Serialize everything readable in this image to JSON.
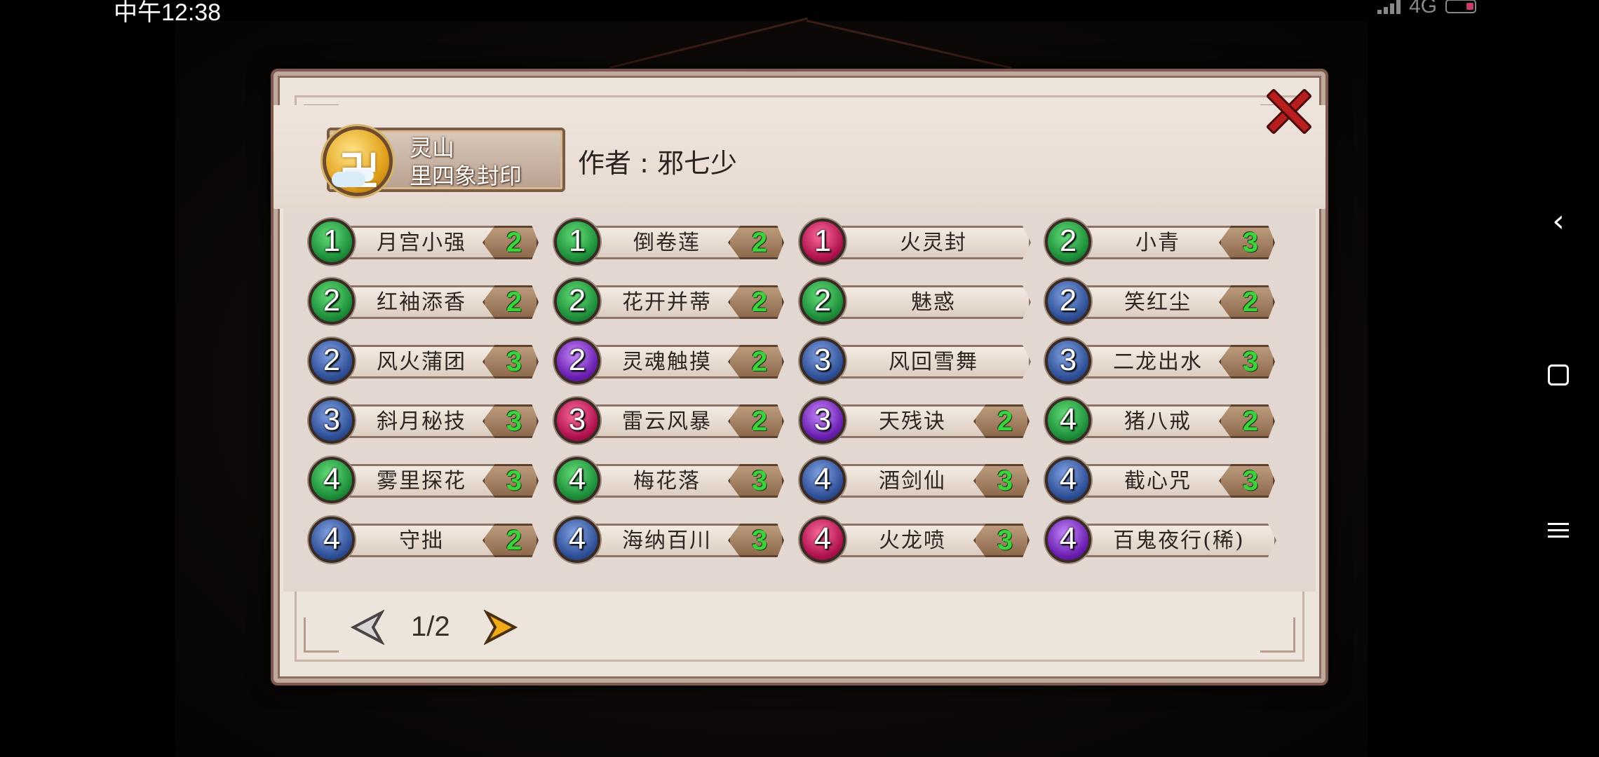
{
  "status": {
    "time": "中午12:38",
    "network": "4G"
  },
  "dialog": {
    "seal_line1": "灵山",
    "seal_line2": "里四象封印",
    "seal_glyph": "卍",
    "author": "作者 : 邪七少",
    "page": "1/2"
  },
  "skills": [
    {
      "level": "1",
      "name": "月宫小强",
      "cost": "2",
      "color": "green"
    },
    {
      "level": "1",
      "name": "倒卷莲",
      "cost": "2",
      "color": "green"
    },
    {
      "level": "1",
      "name": "火灵封",
      "cost": "",
      "color": "red"
    },
    {
      "level": "2",
      "name": "小青",
      "cost": "3",
      "color": "green"
    },
    {
      "level": "2",
      "name": "红袖添香",
      "cost": "2",
      "color": "green"
    },
    {
      "level": "2",
      "name": "花开并蒂",
      "cost": "2",
      "color": "green"
    },
    {
      "level": "2",
      "name": "魅惑",
      "cost": "",
      "color": "green"
    },
    {
      "level": "2",
      "name": "笑红尘",
      "cost": "2",
      "color": "blue"
    },
    {
      "level": "2",
      "name": "风火蒲团",
      "cost": "3",
      "color": "blue"
    },
    {
      "level": "2",
      "name": "灵魂触摸",
      "cost": "2",
      "color": "purple"
    },
    {
      "level": "3",
      "name": "风回雪舞",
      "cost": "",
      "color": "blue"
    },
    {
      "level": "3",
      "name": "二龙出水",
      "cost": "3",
      "color": "blue"
    },
    {
      "level": "3",
      "name": "斜月秘技",
      "cost": "3",
      "color": "blue"
    },
    {
      "level": "3",
      "name": "雷云风暴",
      "cost": "2",
      "color": "red"
    },
    {
      "level": "3",
      "name": "天残诀",
      "cost": "2",
      "color": "purple"
    },
    {
      "level": "4",
      "name": "猪八戒",
      "cost": "2",
      "color": "green"
    },
    {
      "level": "4",
      "name": "雾里探花",
      "cost": "3",
      "color": "green"
    },
    {
      "level": "4",
      "name": "梅花落",
      "cost": "3",
      "color": "green"
    },
    {
      "level": "4",
      "name": "酒剑仙",
      "cost": "3",
      "color": "blue"
    },
    {
      "level": "4",
      "name": "截心咒",
      "cost": "3",
      "color": "blue"
    },
    {
      "level": "4",
      "name": "守拙",
      "cost": "2",
      "color": "blue"
    },
    {
      "level": "4",
      "name": "海纳百川",
      "cost": "3",
      "color": "blue"
    },
    {
      "level": "4",
      "name": "火龙喷",
      "cost": "3",
      "color": "red"
    },
    {
      "level": "4",
      "name": "百鬼夜行(稀)",
      "cost": "",
      "color": "purple"
    }
  ],
  "colors": {
    "cost_text": "#3bd23b",
    "close": "#b81e1e",
    "next_arrow": "#f2a91a"
  }
}
